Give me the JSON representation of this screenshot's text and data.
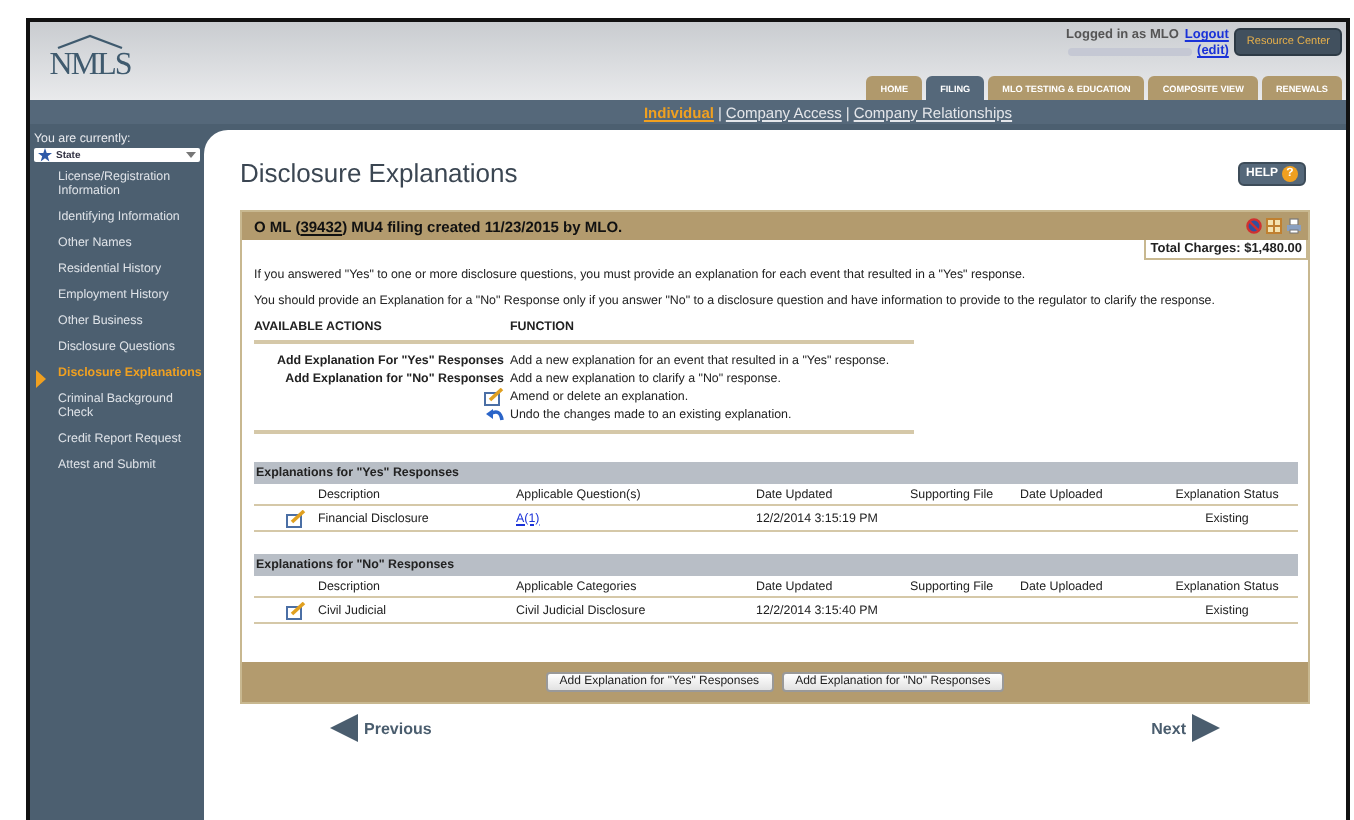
{
  "header": {
    "logo": "NMLS",
    "user": {
      "logged_in": "Logged in as MLO",
      "logout": "Logout",
      "edit": "(edit)"
    },
    "resource_center": "Resource Center"
  },
  "tabs": [
    {
      "label": "HOME",
      "selected": false
    },
    {
      "label": "FILING",
      "selected": true
    },
    {
      "label": "MLO TESTING & EDUCATION",
      "selected": false
    },
    {
      "label": "COMPOSITE VIEW",
      "selected": false
    },
    {
      "label": "RENEWALS",
      "selected": false
    }
  ],
  "subnav": {
    "separator": "|",
    "links": [
      {
        "label": "Individual",
        "selected": true
      },
      {
        "label": "Company Access",
        "selected": false
      },
      {
        "label": "Company Relationships",
        "selected": false
      }
    ]
  },
  "sidebar": {
    "context_label": "You are currently:",
    "context_select": "State",
    "items": [
      {
        "label": "License/Registration Information",
        "selected": false
      },
      {
        "label": "Identifying Information",
        "selected": false
      },
      {
        "label": "Other Names",
        "selected": false
      },
      {
        "label": "Residential History",
        "selected": false
      },
      {
        "label": "Employment History",
        "selected": false
      },
      {
        "label": "Other Business",
        "selected": false
      },
      {
        "label": "Disclosure Questions",
        "selected": false
      },
      {
        "label": "Disclosure Explanations",
        "selected": true
      },
      {
        "label": "Criminal Background Check",
        "selected": false
      },
      {
        "label": "Credit Report Request",
        "selected": false
      },
      {
        "label": "Attest and Submit",
        "selected": false
      }
    ]
  },
  "page_title": "Disclosure Explanations",
  "help": {
    "label": "HELP",
    "icon": "?"
  },
  "panel": {
    "title_before": "O ML (",
    "title_link": "39432",
    "title_after": ") MU4 filing created 11/23/2015 by MLO.",
    "total_charges": "Total Charges: $1,480.00",
    "intro": [
      "If you answered \"Yes\" to one or more disclosure questions, you must provide an explanation for each event that resulted in a \"Yes\" response.",
      "You should provide an Explanation for a \"No\" Response only if you answer \"No\" to a disclosure question and have information to provide to the regulator to clarify the response."
    ],
    "actions": {
      "columns": [
        "AVAILABLE ACTIONS",
        "FUNCTION"
      ],
      "rows": [
        {
          "kind": "text",
          "action": "Add Explanation For \"Yes\" Responses",
          "function": "Add a new explanation for an event that resulted in a \"Yes\" response."
        },
        {
          "kind": "text",
          "action": "Add Explanation for \"No\" Responses",
          "function": "Add a new explanation to clarify a \"No\" response."
        },
        {
          "kind": "edit",
          "function": "Amend or delete an explanation."
        },
        {
          "kind": "undo",
          "function": "Undo the changes made to an existing explanation."
        }
      ]
    },
    "sections": [
      {
        "title": "Explanations for \"Yes\" Responses",
        "columns": [
          "Description",
          "Applicable Question(s)",
          "Date Updated",
          "Supporting File",
          "Date Uploaded",
          "Explanation Status"
        ],
        "rows": [
          {
            "description": "Financial Disclosure",
            "applicable": "A(1)",
            "applicable_link": true,
            "date_updated": "12/2/2014 3:15:19 PM",
            "status": "Existing"
          }
        ]
      },
      {
        "title": "Explanations for \"No\" Responses",
        "columns": [
          "Description",
          "Applicable Categories",
          "Date Updated",
          "Supporting File",
          "Date Uploaded",
          "Explanation Status"
        ],
        "rows": [
          {
            "description": "Civil Judicial",
            "applicable": "Civil Judicial Disclosure",
            "applicable_link": false,
            "date_updated": "12/2/2014 3:15:40 PM",
            "status": "Existing"
          }
        ]
      }
    ],
    "buttons": [
      "Add Explanation for \"Yes\" Responses",
      "Add Explanation for \"No\" Responses"
    ]
  },
  "nav": {
    "previous": "Previous",
    "next": "Next"
  }
}
